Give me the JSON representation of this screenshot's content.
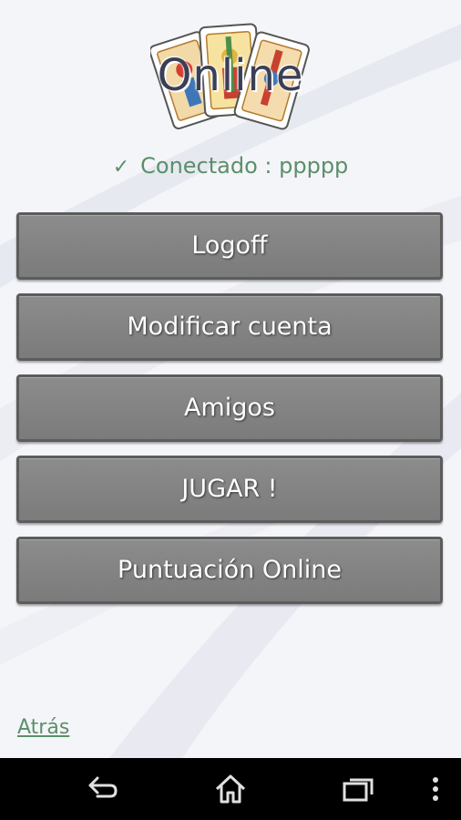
{
  "header": {
    "title": "Online",
    "logo_icon": "playing-cards-icon"
  },
  "status": {
    "icon": "check-icon",
    "text": "Conectado : ppppp"
  },
  "menu": {
    "logoff": "Logoff",
    "modify_account": "Modificar cuenta",
    "friends": "Amigos",
    "play": "JUGAR !",
    "online_score": "Puntuación Online"
  },
  "footer": {
    "back": "Atrás"
  },
  "navbar": {
    "back_icon": "back-arrow-icon",
    "home_icon": "home-icon",
    "recents_icon": "recent-apps-icon",
    "menu_icon": "overflow-menu-icon"
  },
  "colors": {
    "accent_green": "#5b8f6a",
    "button_gray": "#808080",
    "title_dark": "#3a3f55"
  }
}
